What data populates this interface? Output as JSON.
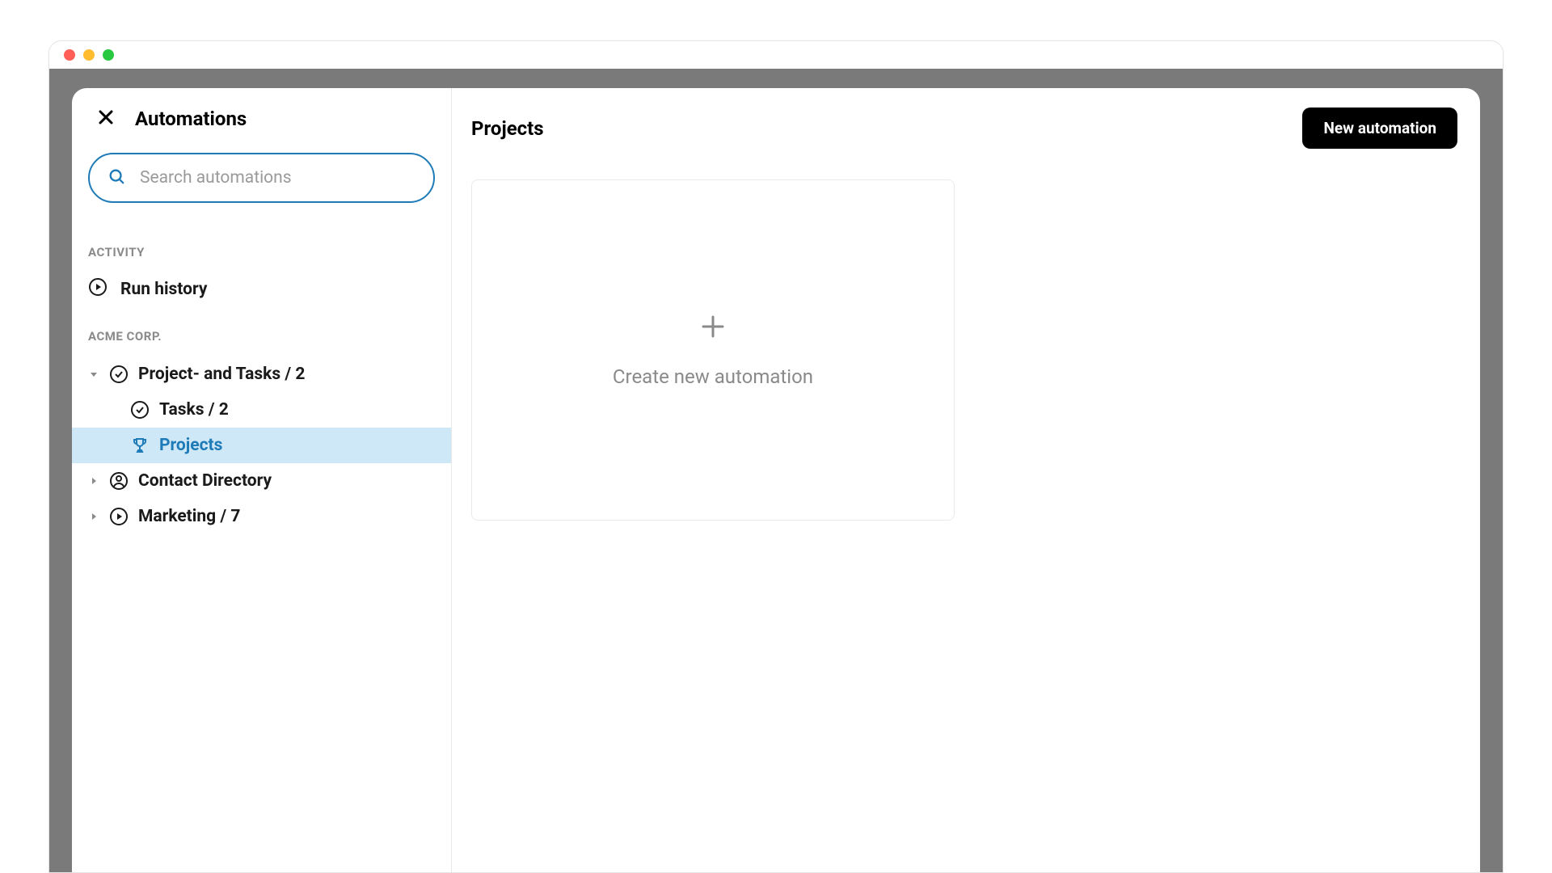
{
  "sidebar": {
    "title": "Automations",
    "search_placeholder": "Search automations",
    "activity_label": "ACTIVITY",
    "run_history_label": "Run history",
    "workspace_label": "ACME CORP."
  },
  "tree": {
    "items": [
      {
        "label": "Project- and Tasks / 2",
        "expanded": true,
        "icon": "check"
      },
      {
        "label": "Tasks / 2",
        "child": true,
        "icon": "check"
      },
      {
        "label": "Projects",
        "child": true,
        "icon": "trophy",
        "selected": true
      },
      {
        "label": "Contact Directory",
        "expanded": false,
        "icon": "user"
      },
      {
        "label": "Marketing / 7",
        "expanded": false,
        "icon": "play"
      }
    ]
  },
  "main": {
    "title": "Projects",
    "new_button_label": "New automation",
    "create_card_label": "Create new automation"
  }
}
